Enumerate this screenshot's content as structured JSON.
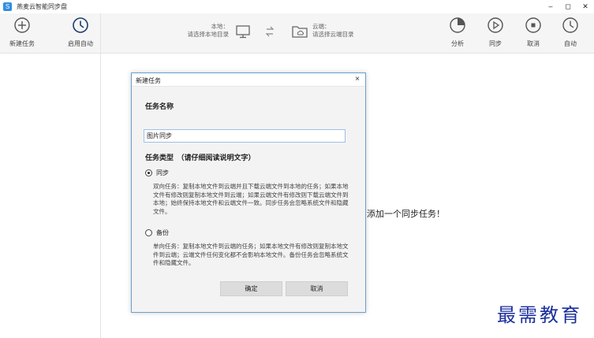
{
  "app": {
    "title": "燕麦云智能同步盘",
    "logo_glyph": "S"
  },
  "window_controls": {
    "minimize": "–",
    "maximize": "◻",
    "close": "✕"
  },
  "toolbar": {
    "new_task": "新建任务",
    "enable_auto": "启用自动",
    "local_label": "本地：",
    "local_path": "请选择本地目录",
    "cloud_label": "云端：",
    "cloud_path": "请选择云端目录",
    "analyze": "分析",
    "sync": "同步",
    "cancel": "取消",
    "auto": "自动"
  },
  "main": {
    "hint": "添加一个同步任务！"
  },
  "watermark": "最需教育",
  "dialog": {
    "title": "新建任务",
    "close": "×",
    "name_heading": "任务名称",
    "name_value": "图片同步",
    "type_heading": "任务类型　（请仔细阅读说明文字）",
    "option_sync": "同步",
    "sync_desc": "双向任务：复制本地文件到云端并且下载云端文件到本地的任务；如果本地文件有修改则复制本地文件到云端；如果云端文件有修改则下载云端文件到本地；始终保持本地文件和云端文件一致。同步任务会忽略系统文件和隐藏文件。",
    "option_backup": "备份",
    "backup_desc": "单向任务：复制本地文件到云端的任务；如果本地文件有修改则复制本地文件到云端；云端文件任何变化都不会影响本地文件。备份任务会忽略系统文件和隐藏文件。",
    "ok": "确定",
    "cancel": "取消",
    "selected_option": "同步"
  },
  "colors": {
    "accent": "#2f8fe0",
    "dialog_border": "#6a9fd0",
    "watermark": "#1b2f9c"
  }
}
